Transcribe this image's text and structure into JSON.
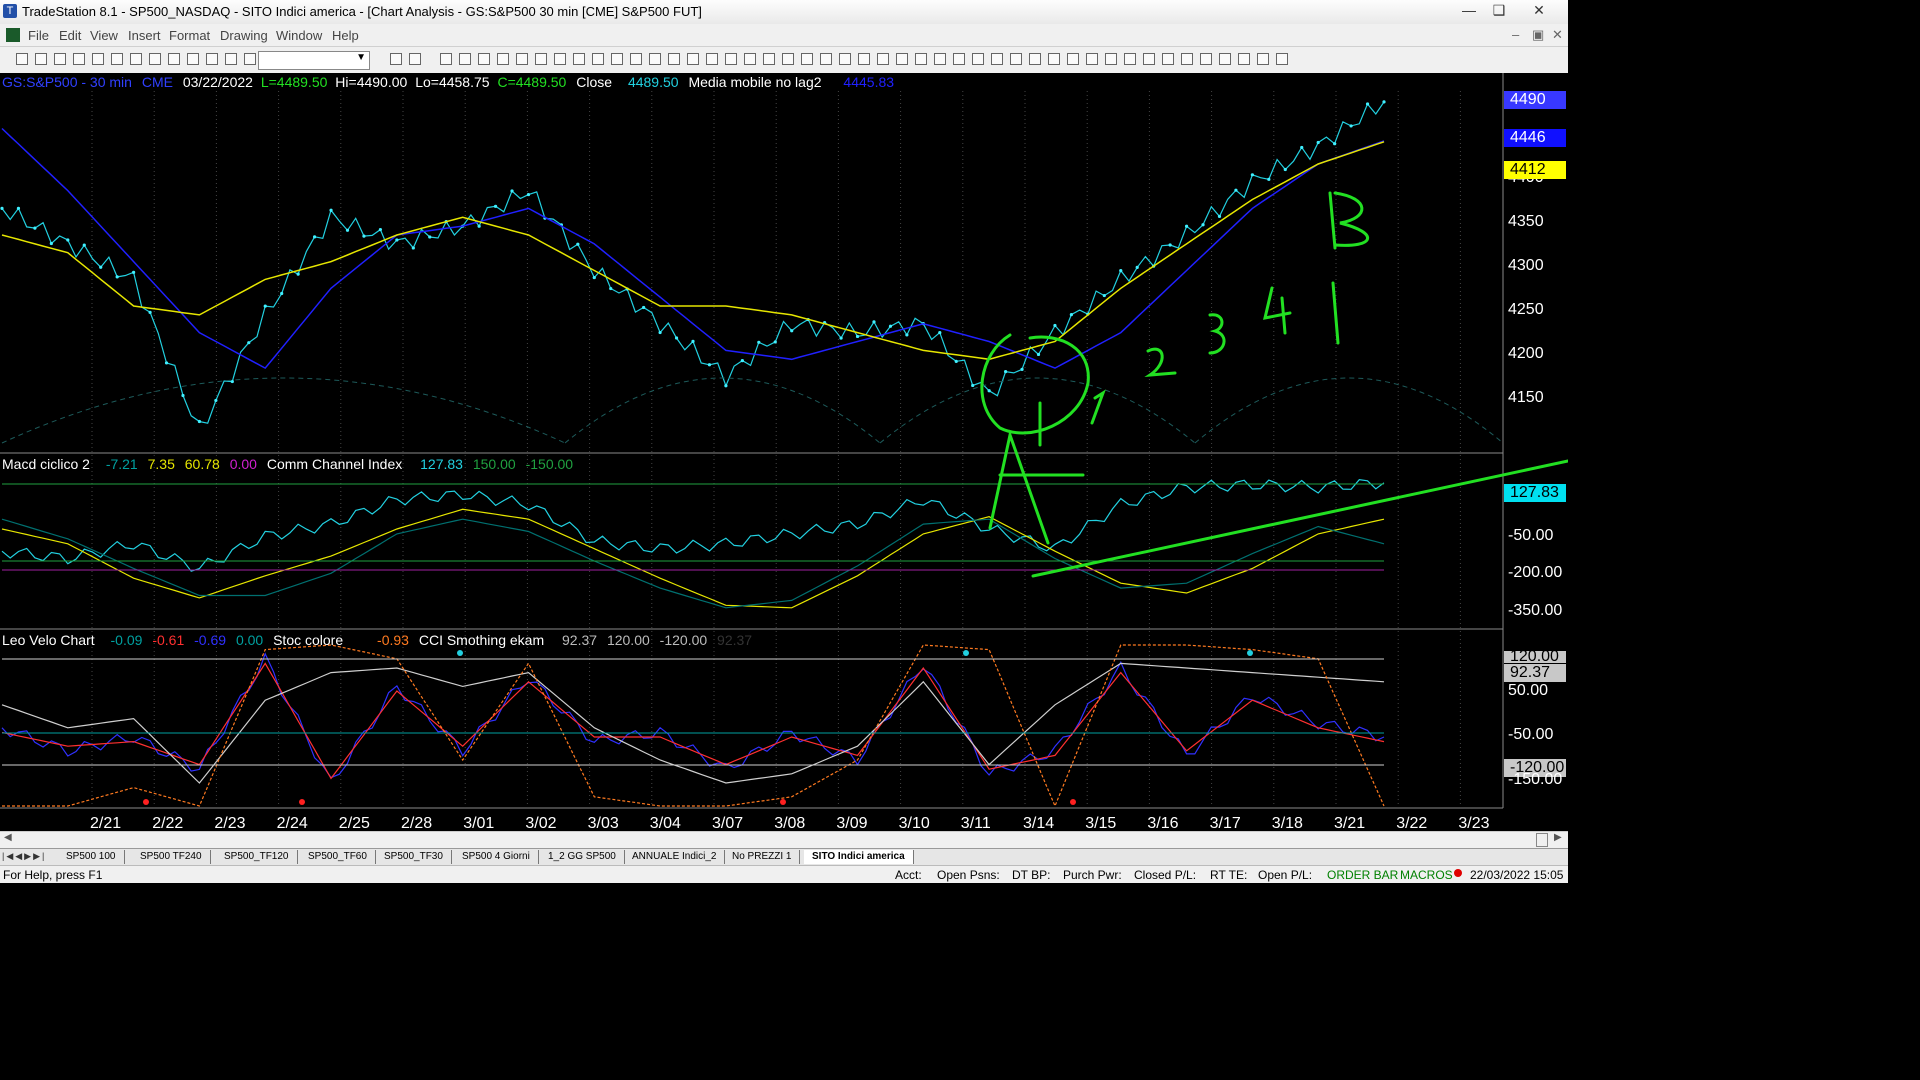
{
  "window": {
    "title": "TradeStation 8.1 - SP500_NASDAQ - SITO Indici america - [Chart Analysis - GS:S&P500  30 min  [CME] S&P500 FUT]"
  },
  "menu": [
    "File",
    "Edit",
    "View",
    "Insert",
    "Format",
    "Drawing",
    "Window",
    "Help"
  ],
  "chart_data": [
    {
      "type": "line",
      "header": {
        "symbol": "GS:S&P500 - 30 min",
        "exchange": "CME",
        "date": "03/22/2022",
        "last": "L=4489.50",
        "high": "Hi=4490.00",
        "low": "Lo=4458.75",
        "close": "C=4489.50",
        "close_label": "Close",
        "close_value": "4489.50",
        "study": "Media mobile no lag2",
        "study_value": "4445.83"
      },
      "x": [
        "2/21",
        "2/22",
        "2/23",
        "2/24",
        "2/25",
        "2/28",
        "3/01",
        "3/02",
        "3/03",
        "3/04",
        "3/07",
        "3/08",
        "3/09",
        "3/10",
        "3/11",
        "3/14",
        "3/15",
        "3/16",
        "3/17",
        "3/18",
        "3/21",
        "3/22",
        "3/23"
      ],
      "y_ticks": [
        "4400",
        "4350",
        "4300",
        "4250",
        "4200",
        "4150"
      ],
      "ylim": [
        4100,
        4500
      ],
      "series": [
        {
          "values": [
            4370,
            4330,
            4290,
            4120,
            4250,
            4360,
            4330,
            4350,
            4390,
            4300,
            4240,
            4180,
            4240,
            4230,
            4240,
            4160,
            4230,
            4290,
            4340,
            4400,
            4440,
            4490
          ],
          "color": "#22d0e0"
        },
        {
          "values": [
            4460,
            4390,
            4310,
            4230,
            4190,
            4280,
            4340,
            4350,
            4370,
            4330,
            4270,
            4210,
            4200,
            4220,
            4240,
            4220,
            4190,
            4230,
            4300,
            4370,
            4420,
            4446
          ],
          "color": "#2020ff"
        },
        {
          "values": [
            4340,
            4320,
            4260,
            4250,
            4290,
            4310,
            4340,
            4360,
            4340,
            4300,
            4260,
            4260,
            4250,
            4230,
            4210,
            4200,
            4220,
            4280,
            4330,
            4380,
            4420,
            4445
          ],
          "color": "#e6e600"
        }
      ],
      "price_labels": [
        {
          "text": "4490",
          "bg": "#3838ff",
          "fg": "#ffffff"
        },
        {
          "text": "4446",
          "bg": "#1010ff",
          "fg": "#ffffff"
        },
        {
          "text": "4412",
          "bg": "#ffff00",
          "fg": "#000000"
        }
      ],
      "annotations": [
        "A",
        "B",
        "1",
        "2",
        "3",
        "4",
        "1",
        "1"
      ]
    },
    {
      "type": "line",
      "header": {
        "name": "Macd ciclico 2",
        "v1": "-7.21",
        "v2": "7.35",
        "v3": "60.78",
        "v4": "0.00",
        "name2": "Comm Channel Index",
        "v5": "127.83",
        "v6": "150.00",
        "v7": "-150.00"
      },
      "y_ticks": [
        "-50.00",
        "-200.00",
        "-350.00"
      ],
      "value_label": "127.83",
      "ylim": [
        -450,
        200
      ],
      "series": [
        {
          "values": [
            -150,
            -180,
            -120,
            -220,
            -90,
            -40,
            60,
            80,
            40,
            -110,
            -140,
            -120,
            -80,
            -40,
            60,
            -60,
            -140,
            40,
            110,
            120,
            110,
            127.83
          ],
          "color": "#22d0e0"
        },
        {
          "values": [
            -60,
            -120,
            -260,
            -340,
            -250,
            -170,
            -60,
            20,
            -20,
            -140,
            -260,
            -370,
            -380,
            -250,
            -80,
            -10,
            -150,
            -280,
            -320,
            -220,
            -80,
            -20
          ],
          "color": "#e6e600"
        },
        {
          "values": [
            -20,
            -100,
            -220,
            -330,
            -330,
            -240,
            -80,
            -20,
            -70,
            -190,
            -300,
            -380,
            -350,
            -210,
            -40,
            -20,
            -180,
            -300,
            -280,
            -160,
            -50,
            -120
          ],
          "color": "#007070"
        }
      ]
    },
    {
      "type": "line",
      "header": {
        "name": "Leo Velo Chart",
        "v1": "-0.09",
        "v2": "-0.61",
        "v3": "-0.69",
        "v4": "0.00",
        "name2": "Stoc colore",
        "v5": "-0.93",
        "name3": "CCI Smothing ekam",
        "v6": "92.37",
        "v7": "120.00",
        "v8": "-120.00",
        "v9": "92.37"
      },
      "y_ticks": [
        "120.00",
        "50.00",
        "-50.00",
        "-120.00",
        "-150.00"
      ],
      "value_label": "92.37",
      "ylim": [
        -200,
        150
      ],
      "series": [
        {
          "values": [
            -30,
            -80,
            -50,
            -120,
            120,
            -150,
            60,
            -80,
            80,
            -60,
            -40,
            -120,
            -40,
            -100,
            110,
            -130,
            -80,
            100,
            -90,
            40,
            -20,
            -50
          ],
          "color": "#3030ff"
        },
        {
          "values": [
            -40,
            -70,
            -60,
            -110,
            110,
            -140,
            50,
            -70,
            70,
            -50,
            -50,
            -110,
            -50,
            -90,
            100,
            -120,
            -90,
            90,
            -80,
            30,
            -30,
            -60
          ],
          "color": "#ff3030"
        },
        {
          "values": [
            20,
            -30,
            -10,
            -150,
            30,
            90,
            100,
            60,
            90,
            -30,
            -100,
            -150,
            -130,
            -70,
            70,
            -110,
            20,
            110,
            100,
            90,
            80,
            70
          ],
          "color": "#cfcfcf"
        },
        {
          "values": [
            -200,
            -200,
            -160,
            -200,
            140,
            150,
            120,
            -100,
            110,
            -180,
            -200,
            -200,
            -180,
            -100,
            150,
            140,
            -200,
            150,
            150,
            140,
            120,
            -200
          ],
          "color": "#ff7a20"
        }
      ]
    }
  ],
  "tabs": [
    "SP500 100",
    "SP500 TF240",
    "SP500_TF120",
    "SP500_TF60",
    "SP500_TF30",
    "SP500 4 Giorni",
    "1_2 GG SP500",
    "ANNUALE Indici_2",
    "No PREZZI 1",
    "SITO Indici america"
  ],
  "active_tab_index": 9,
  "status": {
    "help": "For Help, press F1",
    "acct": "Acct:",
    "open_psns": "Open Psns:",
    "dt_bp": "DT BP:",
    "purch_pwr": "Purch Pwr:",
    "closed_pl": "Closed P/L:",
    "rt_te": "RT TE:",
    "open_pl": "Open P/L:",
    "order_bar": "ORDER BAR",
    "macros": "MACROS",
    "datetime": "22/03/2022 15:05"
  },
  "colors": {
    "price": "#22d0e0",
    "ma_blue": "#2020ff",
    "ma_yellow": "#e6e600",
    "drawing": "#22e022",
    "status_green": "#008000"
  }
}
